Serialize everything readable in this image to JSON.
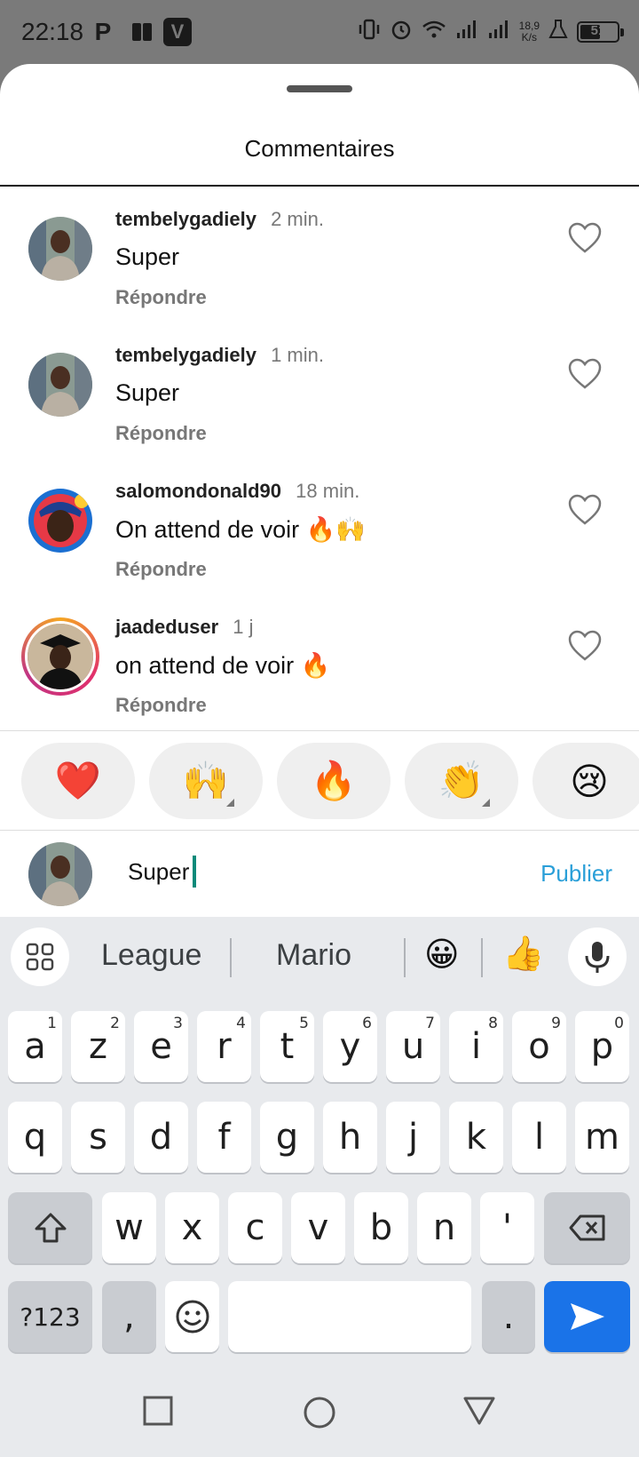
{
  "status_bar": {
    "time": "22:18",
    "app_icons": [
      "P",
      "V"
    ],
    "network_speed_top": "18,9",
    "network_speed_bottom": "K/s",
    "battery_level": "51"
  },
  "sheet": {
    "title": "Commentaires"
  },
  "comments": [
    {
      "username": "tembelygadiely",
      "time": "2 min.",
      "text": "Super",
      "reply_label": "Répondre",
      "avatar": "avatar-man-photo"
    },
    {
      "username": "tembelygadiely",
      "time": "1 min.",
      "text": "Super",
      "reply_label": "Répondre",
      "avatar": "avatar-man-photo"
    },
    {
      "username": "salomondonald90",
      "time": "18 min.",
      "text": "On attend de voir 🔥🙌",
      "reply_label": "Répondre",
      "avatar": "avatar-blue-cap"
    },
    {
      "username": "jaadeduser",
      "time": "1 j",
      "text": "on attend de voir 🔥",
      "reply_label": "Répondre",
      "avatar": "avatar-graduate-story-ring"
    }
  ],
  "reactions": [
    "❤️",
    "🙌",
    "🔥",
    "👏",
    "😢"
  ],
  "composer": {
    "value": "Super",
    "publish_label": "Publier"
  },
  "keyboard": {
    "suggestions": [
      "League",
      "Mario"
    ],
    "suggestion_emojis": [
      "😀",
      "👍"
    ],
    "row1": [
      {
        "k": "a",
        "n": "1"
      },
      {
        "k": "z",
        "n": "2"
      },
      {
        "k": "e",
        "n": "3"
      },
      {
        "k": "r",
        "n": "4"
      },
      {
        "k": "t",
        "n": "5"
      },
      {
        "k": "y",
        "n": "6"
      },
      {
        "k": "u",
        "n": "7"
      },
      {
        "k": "i",
        "n": "8"
      },
      {
        "k": "o",
        "n": "9"
      },
      {
        "k": "p",
        "n": "0"
      }
    ],
    "row2": [
      "q",
      "s",
      "d",
      "f",
      "g",
      "h",
      "j",
      "k",
      "l",
      "m"
    ],
    "row3": [
      "w",
      "x",
      "c",
      "v",
      "b",
      "n",
      "'"
    ],
    "symbols_label": "?123",
    "comma": ",",
    "period": "."
  },
  "colors": {
    "accent_link": "#2a9fd8",
    "keyboard_action": "#1a73e8",
    "caret": "#0a8a7a"
  }
}
